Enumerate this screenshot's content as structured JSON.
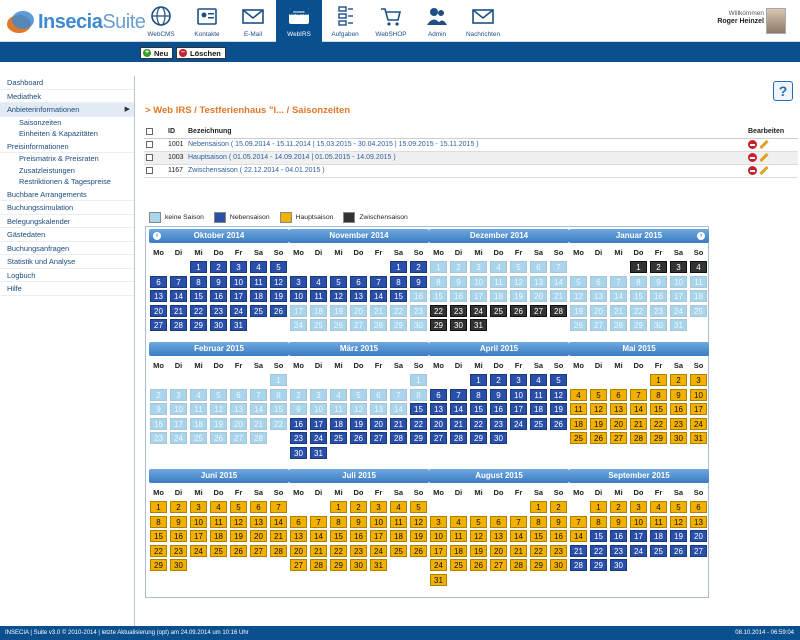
{
  "app": {
    "logo_bold": "Insecia",
    "logo_light": "Suite"
  },
  "nav": [
    {
      "label": "WebCMS",
      "icon": "globe-icon"
    },
    {
      "label": "Kontakte",
      "icon": "contact-card-icon"
    },
    {
      "label": "E-Mail",
      "icon": "envelope-icon"
    },
    {
      "label": "WebIRS",
      "icon": "rooms-available-icon",
      "active": true,
      "badge": "ROOMS AVAILABLE"
    },
    {
      "label": "Aufgaben",
      "icon": "tasks-icon"
    },
    {
      "label": "WebSHOP",
      "icon": "shopping-cart-icon"
    },
    {
      "label": "Admin",
      "icon": "users-icon"
    },
    {
      "label": "Nachrichten",
      "icon": "envelope-icon"
    }
  ],
  "user": {
    "greeting": "Willkommen",
    "name": "Roger Heinzel"
  },
  "toolbar": {
    "new_label": "Neu",
    "delete_label": "Löschen"
  },
  "sidebar": [
    {
      "label": "Dashboard"
    },
    {
      "label": "Mediathek"
    },
    {
      "label": "Anbieterinformationen",
      "selected": true,
      "arrow": "▶"
    },
    {
      "label": "Saisonzeiten",
      "sub": true
    },
    {
      "label": "Einheiten & Kapazitäten",
      "sub": true
    },
    {
      "label": "Preisinformationen"
    },
    {
      "label": "Preismatrix & Preisraten",
      "sub": true
    },
    {
      "label": "Zusatzleistungen",
      "sub": true
    },
    {
      "label": "Restriktionen & Tagespreise",
      "sub": true
    },
    {
      "label": "Buchbare Arrangements"
    },
    {
      "label": "Buchungssimulation"
    },
    {
      "label": "Belegungskalender"
    },
    {
      "label": "Gästedaten"
    },
    {
      "label": "Buchungsanfragen"
    },
    {
      "label": "Statistik und Analyse"
    },
    {
      "label": "Logbuch"
    },
    {
      "label": "Hilfe"
    }
  ],
  "help_label": "?",
  "breadcrumb": "> Web IRS / Testferienhaus \"I... / Saisonzeiten",
  "table": {
    "headers": {
      "id": "ID",
      "name": "Bezeichnung",
      "edit": "Bearbeiten"
    },
    "rows": [
      {
        "id": "1001",
        "name": "Nebensaison",
        "periods": "( 15.09.2014 - 15.11.2014 | 15.03.2015 - 30.04.2015 | 15.09.2015 - 15.11.2015 )"
      },
      {
        "id": "1003",
        "name": "Hauptsaison",
        "periods": "( 01.05.2014 - 14.09.2014 | 01.05.2015 - 14.09.2015 )"
      },
      {
        "id": "1167",
        "name": "Zwischensaison",
        "periods": "( 22.12.2014 - 04.01.2015 )"
      }
    ]
  },
  "legend": [
    {
      "label": "keine Saison",
      "color": "#a8d4ec"
    },
    {
      "label": "Nebensaison",
      "color": "#2a4fa8"
    },
    {
      "label": "Hauptsaison",
      "color": "#f2b100"
    },
    {
      "label": "Zwischensaison",
      "color": "#333333"
    }
  ],
  "weekdays": [
    "Mo",
    "Di",
    "Mi",
    "Do",
    "Fr",
    "Sa",
    "So"
  ],
  "months": [
    {
      "title": "Oktober 2014",
      "offset": 2,
      "days": 31,
      "seasons": [
        [
          1,
          31,
          "n"
        ]
      ]
    },
    {
      "title": "November 2014",
      "offset": 5,
      "days": 30,
      "seasons": [
        [
          1,
          15,
          "n"
        ],
        [
          16,
          30,
          "k"
        ]
      ]
    },
    {
      "title": "Dezember 2014",
      "offset": 0,
      "days": 31,
      "seasons": [
        [
          1,
          21,
          "k"
        ],
        [
          22,
          31,
          "z"
        ]
      ]
    },
    {
      "title": "Januar 2015",
      "offset": 3,
      "days": 31,
      "seasons": [
        [
          1,
          4,
          "z"
        ],
        [
          5,
          31,
          "k"
        ]
      ]
    },
    {
      "title": "Februar 2015",
      "offset": 6,
      "days": 28,
      "seasons": [
        [
          1,
          28,
          "k"
        ]
      ]
    },
    {
      "title": "März 2015",
      "offset": 6,
      "days": 31,
      "seasons": [
        [
          1,
          14,
          "k"
        ],
        [
          15,
          31,
          "n"
        ]
      ]
    },
    {
      "title": "April 2015",
      "offset": 2,
      "days": 30,
      "seasons": [
        [
          1,
          30,
          "n"
        ]
      ]
    },
    {
      "title": "Mai 2015",
      "offset": 4,
      "days": 31,
      "seasons": [
        [
          1,
          31,
          "h"
        ]
      ]
    },
    {
      "title": "Juni 2015",
      "offset": 0,
      "days": 30,
      "seasons": [
        [
          1,
          30,
          "h"
        ]
      ]
    },
    {
      "title": "Juli 2015",
      "offset": 2,
      "days": 31,
      "seasons": [
        [
          1,
          31,
          "h"
        ]
      ]
    },
    {
      "title": "August 2015",
      "offset": 5,
      "days": 31,
      "seasons": [
        [
          1,
          31,
          "h"
        ]
      ]
    },
    {
      "title": "September 2015",
      "offset": 1,
      "days": 30,
      "seasons": [
        [
          1,
          14,
          "h"
        ],
        [
          15,
          30,
          "n"
        ]
      ]
    }
  ],
  "footer": {
    "left": "INSECIA | Suite v3.0 © 2010-2014 | letzte Aktualisierung (opt) am 24.09.2014 um 10:16 Uhr",
    "right": "08.10.2014 - 06:59:04"
  }
}
